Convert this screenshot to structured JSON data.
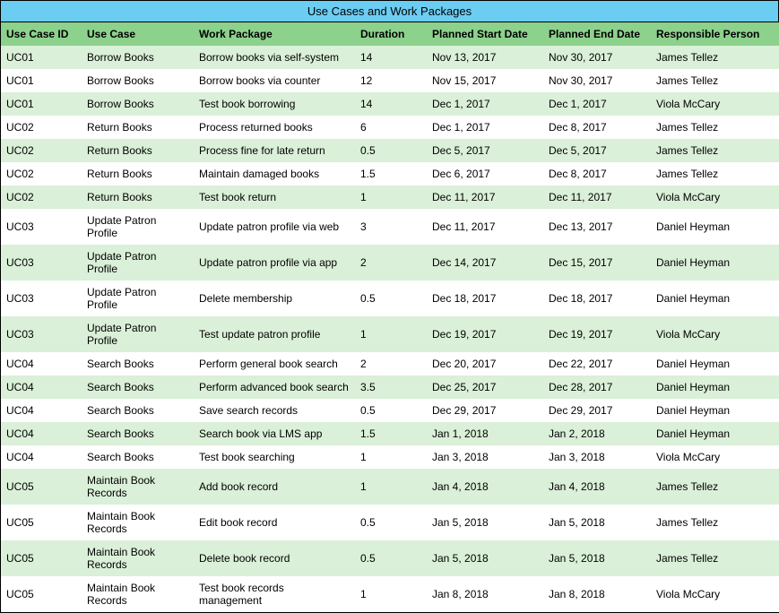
{
  "title": "Use Cases and Work Packages",
  "headers": [
    "Use Case ID",
    "Use Case",
    "Work Package",
    "Duration",
    "Planned Start Date",
    "Planned End Date",
    "Responsible Person"
  ],
  "rows": [
    {
      "id": "UC01",
      "uc": "Borrow Books",
      "wp": "Borrow books via self-system",
      "dur": "14",
      "start": "Nov 13, 2017",
      "end": "Nov 30, 2017",
      "resp": "James Tellez"
    },
    {
      "id": "UC01",
      "uc": "Borrow Books",
      "wp": "Borrow books via counter",
      "dur": "12",
      "start": "Nov 15, 2017",
      "end": "Nov 30, 2017",
      "resp": "James Tellez"
    },
    {
      "id": "UC01",
      "uc": "Borrow Books",
      "wp": "Test book borrowing",
      "dur": "14",
      "start": "Dec 1, 2017",
      "end": "Dec 1, 2017",
      "resp": "Viola McCary"
    },
    {
      "id": "UC02",
      "uc": "Return Books",
      "wp": "Process returned books",
      "dur": "6",
      "start": "Dec 1, 2017",
      "end": "Dec 8, 2017",
      "resp": "James Tellez"
    },
    {
      "id": "UC02",
      "uc": "Return Books",
      "wp": "Process fine for late return",
      "dur": "0.5",
      "start": "Dec 5, 2017",
      "end": "Dec 5, 2017",
      "resp": "James Tellez"
    },
    {
      "id": "UC02",
      "uc": "Return Books",
      "wp": "Maintain damaged books",
      "dur": "1.5",
      "start": "Dec 6, 2017",
      "end": "Dec 8, 2017",
      "resp": "James Tellez"
    },
    {
      "id": "UC02",
      "uc": "Return Books",
      "wp": "Test book return",
      "dur": "1",
      "start": "Dec 11, 2017",
      "end": "Dec 11, 2017",
      "resp": "Viola McCary"
    },
    {
      "id": "UC03",
      "uc": "Update Patron Profile",
      "wp": "Update patron profile via web",
      "dur": "3",
      "start": "Dec 11, 2017",
      "end": "Dec 13, 2017",
      "resp": "Daniel Heyman"
    },
    {
      "id": "UC03",
      "uc": "Update Patron Profile",
      "wp": "Update patron profile via app",
      "dur": "2",
      "start": "Dec 14, 2017",
      "end": "Dec 15, 2017",
      "resp": "Daniel Heyman"
    },
    {
      "id": "UC03",
      "uc": "Update Patron Profile",
      "wp": "Delete membership",
      "dur": "0.5",
      "start": "Dec 18, 2017",
      "end": "Dec 18, 2017",
      "resp": "Daniel Heyman"
    },
    {
      "id": "UC03",
      "uc": "Update Patron Profile",
      "wp": "Test update patron profile",
      "dur": "1",
      "start": "Dec 19, 2017",
      "end": "Dec 19, 2017",
      "resp": "Viola McCary"
    },
    {
      "id": "UC04",
      "uc": "Search Books",
      "wp": "Perform general book search",
      "dur": "2",
      "start": "Dec 20, 2017",
      "end": "Dec 22, 2017",
      "resp": "Daniel Heyman"
    },
    {
      "id": "UC04",
      "uc": "Search Books",
      "wp": "Perform advanced book search",
      "dur": "3.5",
      "start": "Dec 25, 2017",
      "end": "Dec 28, 2017",
      "resp": "Daniel Heyman"
    },
    {
      "id": "UC04",
      "uc": "Search Books",
      "wp": "Save search records",
      "dur": "0.5",
      "start": "Dec 29, 2017",
      "end": "Dec 29, 2017",
      "resp": "Daniel Heyman"
    },
    {
      "id": "UC04",
      "uc": "Search Books",
      "wp": "Search book via LMS app",
      "dur": "1.5",
      "start": "Jan 1, 2018",
      "end": "Jan 2, 2018",
      "resp": "Daniel Heyman"
    },
    {
      "id": "UC04",
      "uc": "Search Books",
      "wp": "Test book searching",
      "dur": "1",
      "start": "Jan 3, 2018",
      "end": "Jan 3, 2018",
      "resp": "Viola McCary"
    },
    {
      "id": "UC05",
      "uc": "Maintain Book Records",
      "wp": "Add book record",
      "dur": "1",
      "start": "Jan 4, 2018",
      "end": "Jan 4, 2018",
      "resp": "James Tellez"
    },
    {
      "id": "UC05",
      "uc": "Maintain Book Records",
      "wp": "Edit book record",
      "dur": "0.5",
      "start": "Jan 5, 2018",
      "end": "Jan 5, 2018",
      "resp": "James Tellez"
    },
    {
      "id": "UC05",
      "uc": "Maintain Book Records",
      "wp": "Delete book record",
      "dur": "0.5",
      "start": "Jan 5, 2018",
      "end": "Jan 5, 2018",
      "resp": "James Tellez"
    },
    {
      "id": "UC05",
      "uc": "Maintain Book Records",
      "wp": "Test book records management",
      "dur": "1",
      "start": "Jan 8, 2018",
      "end": "Jan 8, 2018",
      "resp": "Viola McCary"
    }
  ]
}
